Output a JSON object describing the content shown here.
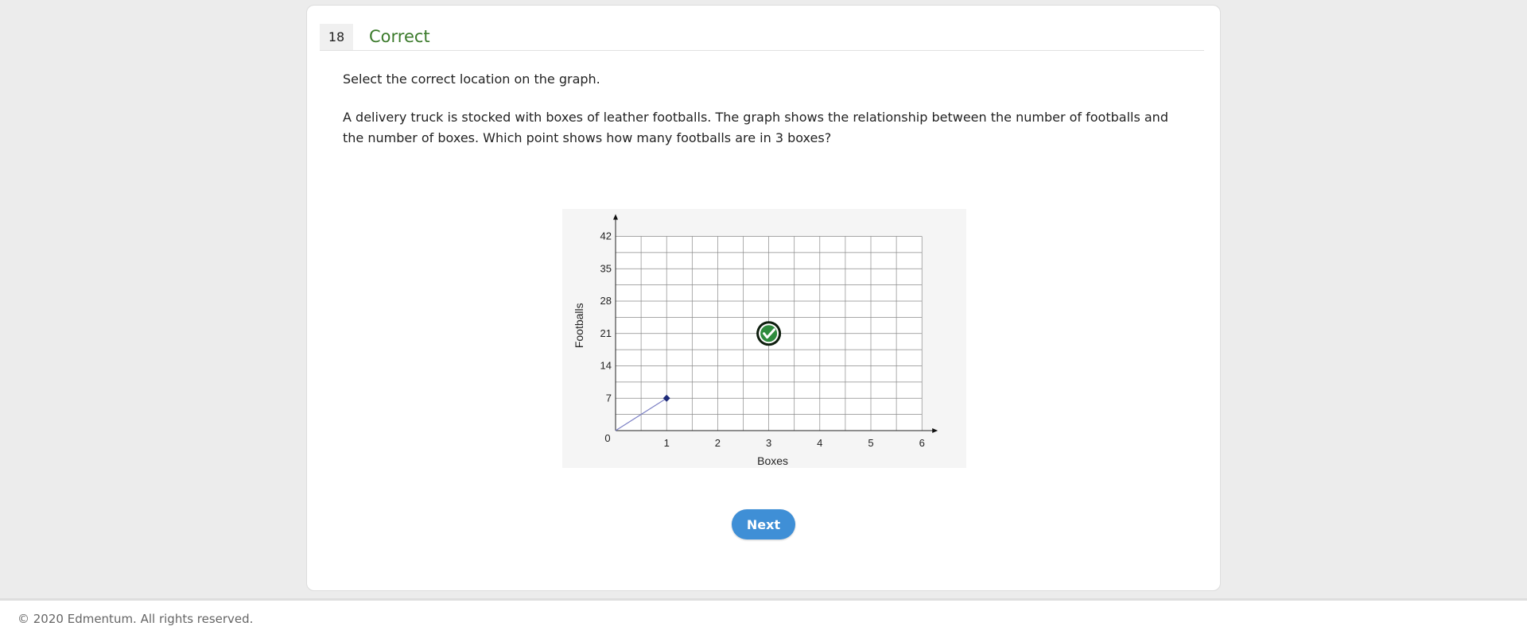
{
  "question": {
    "number": "18",
    "status": "Correct",
    "instruction": "Select the correct location on the graph.",
    "prompt": "A delivery truck is stocked with boxes of leather footballs. The graph shows the relationship between the number of footballs and the number of boxes. Which point shows how many footballs are in 3 boxes?"
  },
  "colors": {
    "status_green": "#3b7a2b",
    "button_blue": "#3f8fd6",
    "point_navy": "#1e2a78",
    "check_green": "#2e8b3d"
  },
  "chart_data": {
    "type": "line",
    "xlabel": "Boxes",
    "ylabel": "Footballs",
    "x_ticks": [
      "1",
      "2",
      "3",
      "4",
      "5",
      "6"
    ],
    "y_ticks": [
      "7",
      "14",
      "21",
      "28",
      "35",
      "42"
    ],
    "origin_label": "0",
    "xlim": [
      0,
      6
    ],
    "ylim": [
      0,
      42
    ],
    "grid": true,
    "series": [
      {
        "x": [
          0,
          1
        ],
        "y": [
          0,
          7
        ]
      }
    ],
    "selected_point": {
      "x": 3,
      "y": 21,
      "icon": "check-circle-icon",
      "result": "correct"
    }
  },
  "buttons": {
    "next_label": "Next"
  },
  "footer": {
    "copyright": "© 2020 Edmentum. All rights reserved."
  }
}
